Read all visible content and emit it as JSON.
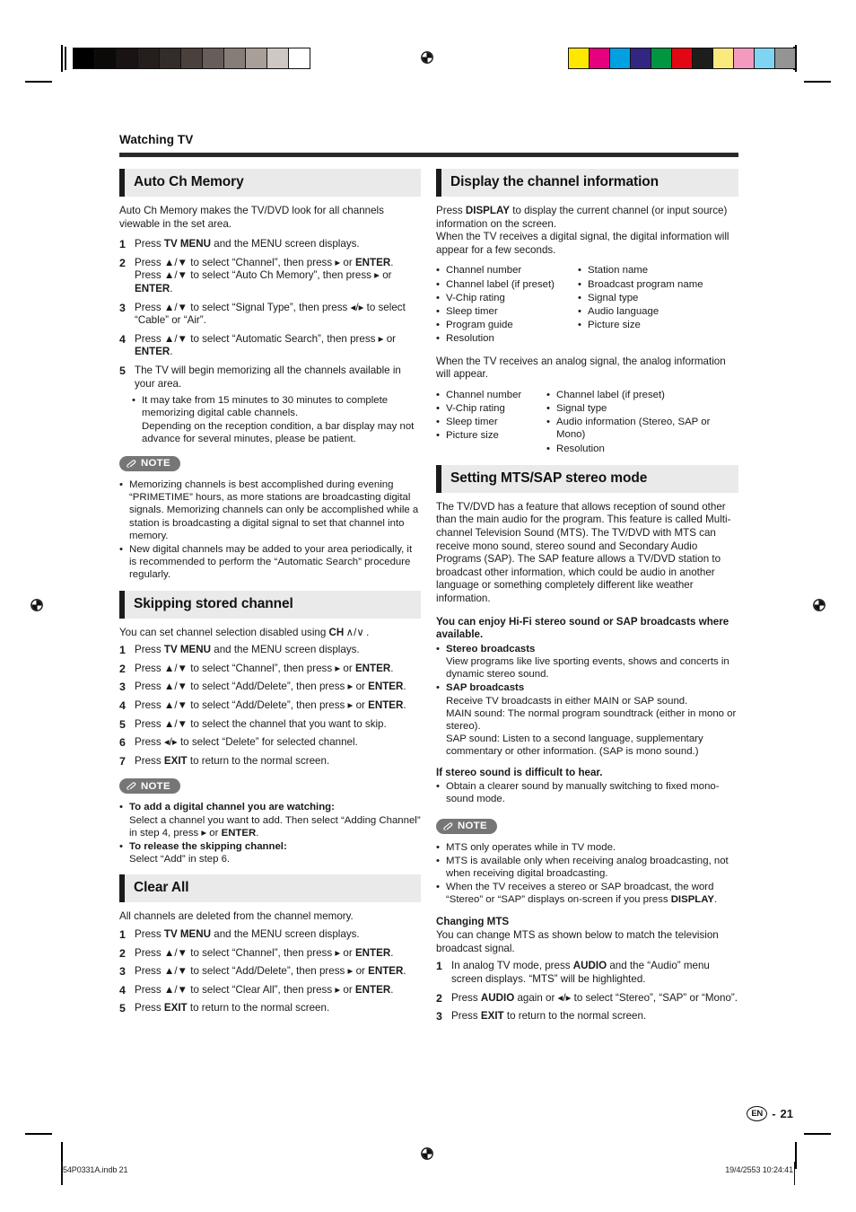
{
  "printer_marks": {
    "grayscale_swatches": [
      "#000000",
      "#0c0a09",
      "#191413",
      "#251e1c",
      "#342c29",
      "#4a403c",
      "#685e59",
      "#877d77",
      "#a89f99",
      "#cfc7c2",
      "#ffffff"
    ],
    "color_swatches": [
      "#ffe800",
      "#e6007e",
      "#00a0e3",
      "#312783",
      "#009640",
      "#e30613",
      "#1d1d1b",
      "#faea7d",
      "#f49ac1",
      "#7fd4f4",
      "#949494"
    ]
  },
  "header": {
    "chapter": "Watching TV"
  },
  "left_column": {
    "auto_ch_memory": {
      "heading": "Auto Ch Memory",
      "intro": "Auto Ch Memory makes the TV/DVD look for all channels viewable in the set area.",
      "steps": [
        {
          "num": "1",
          "text_html": "Press <b>TV MENU</b> and the MENU screen displays."
        },
        {
          "num": "2",
          "text_html": "Press ▲/▼ to select “Channel”, then press ▸ or <b>ENTER</b>. Press ▲/▼ to select “Auto Ch Memory”, then press ▸ or <b>ENTER</b>."
        },
        {
          "num": "3",
          "text_html": "Press ▲/▼ to select “Signal Type”, then press ◂/▸ to select “Cable” or “Air”."
        },
        {
          "num": "4",
          "text_html": "Press ▲/▼ to select “Automatic Search”, then press ▸ or <b>ENTER</b>."
        },
        {
          "num": "5",
          "text_html": "The TV will begin memorizing all the channels available in your area."
        }
      ],
      "step5_subbullets": [
        "It may take from 15 minutes to 30 minutes to complete memorizing digital cable channels.<br>Depending on the reception condition, a bar display may not advance for several minutes, please be patient."
      ],
      "note_label": "NOTE",
      "notes": [
        "Memorizing channels is best accomplished during evening “PRIMETIME” hours, as more stations are broadcasting digital signals. Memorizing channels can only be accomplished while a station is broadcasting a digital signal to set that channel into memory.",
        "New digital channels may be added to your area periodically, it is recommended to perform the “Automatic Search” procedure regularly."
      ]
    },
    "skipping_stored_channel": {
      "heading": "Skipping stored channel",
      "intro_html": "You can set channel selection disabled using <b>CH</b> ∧/∨ .",
      "steps": [
        {
          "num": "1",
          "text_html": "Press <b>TV MENU</b> and the MENU screen displays."
        },
        {
          "num": "2",
          "text_html": "Press ▲/▼ to select “Channel”, then press ▸ or <b>ENTER</b>."
        },
        {
          "num": "3",
          "text_html": "Press ▲/▼ to select “Add/Delete”, then press ▸ or <b>ENTER</b>."
        },
        {
          "num": "4",
          "text_html": "Press ▲/▼ to select “Add/Delete”, then press ▸ or <b>ENTER</b>."
        },
        {
          "num": "5",
          "text_html": "Press ▲/▼ to select the channel that you want to skip."
        },
        {
          "num": "6",
          "text_html": "Press ◂/▸ to select “Delete” for selected channel."
        },
        {
          "num": "7",
          "text_html": "Press <b>EXIT</b> to return to the normal screen."
        }
      ],
      "note_label": "NOTE",
      "notes_html": [
        "<b>To add a digital channel you are watching:</b><br>Select a channel you want to add. Then select “Adding Channel” in step 4, press ▸ or <b>ENTER</b>.",
        "<b>To release the skipping channel:</b><br>Select “Add” in step 6."
      ]
    },
    "clear_all": {
      "heading": "Clear All",
      "intro": "All channels are deleted from the channel memory.",
      "steps": [
        {
          "num": "1",
          "text_html": "Press <b>TV MENU</b> and the MENU screen displays."
        },
        {
          "num": "2",
          "text_html": "Press ▲/▼ to select “Channel”, then press ▸ or <b>ENTER</b>."
        },
        {
          "num": "3",
          "text_html": "Press ▲/▼ to select “Add/Delete”, then press ▸ or <b>ENTER</b>."
        },
        {
          "num": "4",
          "text_html": "Press ▲/▼ to select “Clear All”, then press ▸ or <b>ENTER</b>."
        },
        {
          "num": "5",
          "text_html": "Press <b>EXIT</b> to return to the normal screen."
        }
      ]
    }
  },
  "right_column": {
    "display_channel_information": {
      "heading": "Display the channel information",
      "intro_html": "Press <b>DISPLAY</b> to display the current channel (or input source) information on the screen.<br>When the TV receives a digital signal, the digital information will appear for a few seconds.",
      "digital_items_col1": [
        "Channel number",
        "Channel label (if preset)",
        "V-Chip rating",
        "Sleep timer",
        "Program guide",
        "Resolution"
      ],
      "digital_items_col2": [
        "Station name",
        "Broadcast program name",
        "Signal type",
        "Audio language",
        "Picture size"
      ],
      "analog_intro": "When the TV receives an analog signal, the analog information will appear.",
      "analog_items_col1": [
        "Channel number",
        "V-Chip rating",
        "Sleep timer",
        "Picture size"
      ],
      "analog_items_col2": [
        "Channel label (if preset)",
        "Signal type",
        "Audio information (Stereo, SAP or Mono)",
        "Resolution"
      ]
    },
    "setting_mts_sap": {
      "heading": "Setting MTS/SAP stereo mode",
      "intro": "The TV/DVD has a feature that allows reception of sound other than the main audio for the program. This feature is called Multi-channel Television Sound (MTS). The TV/DVD with MTS can receive mono sound, stereo sound and Secondary Audio Programs (SAP). The SAP feature allows a TV/DVD station to broadcast other information, which could be audio in another language or something completely different like weather information.",
      "hifi_heading": "You can enjoy Hi-Fi stereo sound or SAP broadcasts where available.",
      "hifi_items_html": [
        "<b>Stereo broadcasts</b><br>View programs like live sporting events, shows and concerts in dynamic stereo sound.",
        "<b>SAP broadcasts</b><br>Receive TV broadcasts in either MAIN or SAP sound.<br>MAIN sound: The normal program soundtrack (either in mono or stereo).<br>SAP sound: Listen to a second language, supplementary commentary or other information. (SAP is mono sound.)"
      ],
      "difficult_heading": "If stereo sound is difficult to hear.",
      "difficult_items": [
        "Obtain a clearer sound by manually switching to fixed mono-sound mode."
      ],
      "note_label": "NOTE",
      "notes_html": [
        "MTS only operates while in TV mode.",
        "MTS is available only when receiving analog broadcasting, not when receiving digital broadcasting.",
        "When the TV receives a stereo or SAP broadcast, the word “Stereo” or “SAP” displays on-screen if you press <b>DISPLAY</b>."
      ],
      "changing_mts_heading": "Changing MTS",
      "changing_mts_intro": "You can change MTS as shown below to match the television broadcast signal.",
      "changing_mts_steps": [
        {
          "num": "1",
          "text_html": "In analog TV mode, press <b>AUDIO</b> and the “Audio” menu screen displays. “MTS” will be highlighted."
        },
        {
          "num": "2",
          "text_html": "Press <b>AUDIO</b> again or ◂/▸ to select “Stereo”, “SAP” or “Mono”."
        },
        {
          "num": "3",
          "text_html": "Press <b>EXIT</b> to return to the normal screen."
        }
      ]
    }
  },
  "page_footer": {
    "language_badge": "EN",
    "page_separator": "-",
    "page_number": "21",
    "file_name": "54P0331A.indb   21",
    "timestamp": "19/4/2553   10:24:41"
  }
}
